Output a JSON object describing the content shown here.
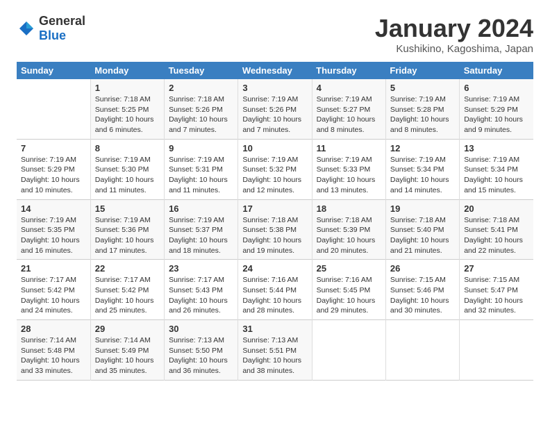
{
  "logo": {
    "text_general": "General",
    "text_blue": "Blue"
  },
  "title": "January 2024",
  "subtitle": "Kushikino, Kagoshima, Japan",
  "days_of_week": [
    "Sunday",
    "Monday",
    "Tuesday",
    "Wednesday",
    "Thursday",
    "Friday",
    "Saturday"
  ],
  "weeks": [
    [
      {
        "day": "",
        "info": ""
      },
      {
        "day": "1",
        "info": "Sunrise: 7:18 AM\nSunset: 5:25 PM\nDaylight: 10 hours\nand 6 minutes."
      },
      {
        "day": "2",
        "info": "Sunrise: 7:18 AM\nSunset: 5:26 PM\nDaylight: 10 hours\nand 7 minutes."
      },
      {
        "day": "3",
        "info": "Sunrise: 7:19 AM\nSunset: 5:26 PM\nDaylight: 10 hours\nand 7 minutes."
      },
      {
        "day": "4",
        "info": "Sunrise: 7:19 AM\nSunset: 5:27 PM\nDaylight: 10 hours\nand 8 minutes."
      },
      {
        "day": "5",
        "info": "Sunrise: 7:19 AM\nSunset: 5:28 PM\nDaylight: 10 hours\nand 8 minutes."
      },
      {
        "day": "6",
        "info": "Sunrise: 7:19 AM\nSunset: 5:29 PM\nDaylight: 10 hours\nand 9 minutes."
      }
    ],
    [
      {
        "day": "7",
        "info": "Sunrise: 7:19 AM\nSunset: 5:29 PM\nDaylight: 10 hours\nand 10 minutes."
      },
      {
        "day": "8",
        "info": "Sunrise: 7:19 AM\nSunset: 5:30 PM\nDaylight: 10 hours\nand 11 minutes."
      },
      {
        "day": "9",
        "info": "Sunrise: 7:19 AM\nSunset: 5:31 PM\nDaylight: 10 hours\nand 11 minutes."
      },
      {
        "day": "10",
        "info": "Sunrise: 7:19 AM\nSunset: 5:32 PM\nDaylight: 10 hours\nand 12 minutes."
      },
      {
        "day": "11",
        "info": "Sunrise: 7:19 AM\nSunset: 5:33 PM\nDaylight: 10 hours\nand 13 minutes."
      },
      {
        "day": "12",
        "info": "Sunrise: 7:19 AM\nSunset: 5:34 PM\nDaylight: 10 hours\nand 14 minutes."
      },
      {
        "day": "13",
        "info": "Sunrise: 7:19 AM\nSunset: 5:34 PM\nDaylight: 10 hours\nand 15 minutes."
      }
    ],
    [
      {
        "day": "14",
        "info": "Sunrise: 7:19 AM\nSunset: 5:35 PM\nDaylight: 10 hours\nand 16 minutes."
      },
      {
        "day": "15",
        "info": "Sunrise: 7:19 AM\nSunset: 5:36 PM\nDaylight: 10 hours\nand 17 minutes."
      },
      {
        "day": "16",
        "info": "Sunrise: 7:19 AM\nSunset: 5:37 PM\nDaylight: 10 hours\nand 18 minutes."
      },
      {
        "day": "17",
        "info": "Sunrise: 7:18 AM\nSunset: 5:38 PM\nDaylight: 10 hours\nand 19 minutes."
      },
      {
        "day": "18",
        "info": "Sunrise: 7:18 AM\nSunset: 5:39 PM\nDaylight: 10 hours\nand 20 minutes."
      },
      {
        "day": "19",
        "info": "Sunrise: 7:18 AM\nSunset: 5:40 PM\nDaylight: 10 hours\nand 21 minutes."
      },
      {
        "day": "20",
        "info": "Sunrise: 7:18 AM\nSunset: 5:41 PM\nDaylight: 10 hours\nand 22 minutes."
      }
    ],
    [
      {
        "day": "21",
        "info": "Sunrise: 7:17 AM\nSunset: 5:42 PM\nDaylight: 10 hours\nand 24 minutes."
      },
      {
        "day": "22",
        "info": "Sunrise: 7:17 AM\nSunset: 5:42 PM\nDaylight: 10 hours\nand 25 minutes."
      },
      {
        "day": "23",
        "info": "Sunrise: 7:17 AM\nSunset: 5:43 PM\nDaylight: 10 hours\nand 26 minutes."
      },
      {
        "day": "24",
        "info": "Sunrise: 7:16 AM\nSunset: 5:44 PM\nDaylight: 10 hours\nand 28 minutes."
      },
      {
        "day": "25",
        "info": "Sunrise: 7:16 AM\nSunset: 5:45 PM\nDaylight: 10 hours\nand 29 minutes."
      },
      {
        "day": "26",
        "info": "Sunrise: 7:15 AM\nSunset: 5:46 PM\nDaylight: 10 hours\nand 30 minutes."
      },
      {
        "day": "27",
        "info": "Sunrise: 7:15 AM\nSunset: 5:47 PM\nDaylight: 10 hours\nand 32 minutes."
      }
    ],
    [
      {
        "day": "28",
        "info": "Sunrise: 7:14 AM\nSunset: 5:48 PM\nDaylight: 10 hours\nand 33 minutes."
      },
      {
        "day": "29",
        "info": "Sunrise: 7:14 AM\nSunset: 5:49 PM\nDaylight: 10 hours\nand 35 minutes."
      },
      {
        "day": "30",
        "info": "Sunrise: 7:13 AM\nSunset: 5:50 PM\nDaylight: 10 hours\nand 36 minutes."
      },
      {
        "day": "31",
        "info": "Sunrise: 7:13 AM\nSunset: 5:51 PM\nDaylight: 10 hours\nand 38 minutes."
      },
      {
        "day": "",
        "info": ""
      },
      {
        "day": "",
        "info": ""
      },
      {
        "day": "",
        "info": ""
      }
    ]
  ]
}
